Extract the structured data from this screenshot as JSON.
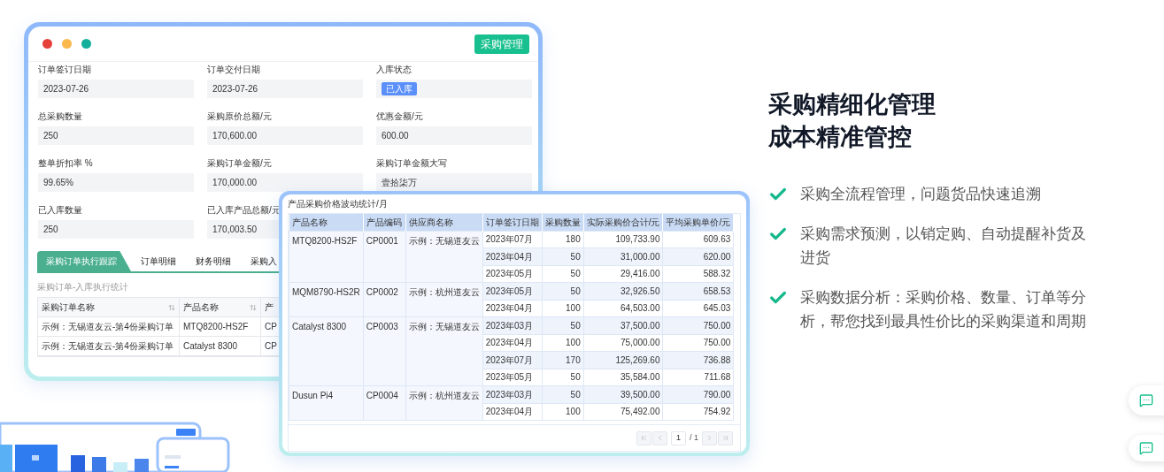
{
  "form_window": {
    "badge": "采购管理",
    "fields": [
      {
        "label": "订单签订日期",
        "value": "2023-07-26",
        "kind": "text"
      },
      {
        "label": "订单交付日期",
        "value": "2023-07-26",
        "kind": "text"
      },
      {
        "label": "入库状态",
        "value": "已入库",
        "kind": "tag"
      },
      {
        "label": "总采购数量",
        "value": "250",
        "kind": "text"
      },
      {
        "label": "采购原价总额/元",
        "value": "170,600.00",
        "kind": "text"
      },
      {
        "label": "优惠金额/元",
        "value": "600.00",
        "kind": "text"
      },
      {
        "label": "整单折扣率 %",
        "value": "99.65%",
        "kind": "text"
      },
      {
        "label": "采购订单金额/元",
        "value": "170,000.00",
        "kind": "text"
      },
      {
        "label": "采购订单金额大写",
        "value": "壹拾柒万",
        "kind": "text"
      },
      {
        "label": "已入库数量",
        "value": "250",
        "kind": "text"
      },
      {
        "label": "已入库产品总额/元",
        "value": "170,003.50",
        "kind": "text"
      }
    ],
    "tabs": [
      {
        "label": "采购订单执行跟踪",
        "selected": true
      },
      {
        "label": "订单明细",
        "selected": false
      },
      {
        "label": "财务明细",
        "selected": false
      },
      {
        "label": "采购入",
        "selected": false
      }
    ],
    "table_title": "采购订单-入库执行统计",
    "table": {
      "columns": [
        {
          "label": "采购订单名称",
          "sortable": true
        },
        {
          "label": "产品名称",
          "sortable": true
        },
        {
          "label": "产"
        }
      ],
      "rows": [
        [
          "示例：无锡道友云-第4份采购订单",
          "MTQ8200-HS2F",
          "CP"
        ],
        [
          "示例：无锡道友云-第4份采购订单",
          "Catalyst 8300",
          "CP"
        ]
      ]
    }
  },
  "price_window": {
    "title": "产品采购价格波动统计/月",
    "columns": [
      "产品名称",
      "产品编码",
      "供应商名称",
      "订单签订日期",
      "采购数量",
      "实际采购价合计/元",
      "平均采购单价/元"
    ],
    "products": [
      {
        "name": "MTQ8200-HS2F",
        "code": "CP0001",
        "supplier": "示例：无锡道友云",
        "months": [
          [
            "2023年07月",
            "180",
            "109,733.90",
            "609.63"
          ],
          [
            "2023年04月",
            "50",
            "31,000.00",
            "620.00"
          ],
          [
            "2023年05月",
            "50",
            "29,416.00",
            "588.32"
          ]
        ]
      },
      {
        "name": "MQM8790-HS2R",
        "code": "CP0002",
        "supplier": "示例：杭州道友云",
        "months": [
          [
            "2023年05月",
            "50",
            "32,926.50",
            "658.53"
          ],
          [
            "2023年04月",
            "100",
            "64,503.00",
            "645.03"
          ]
        ]
      },
      {
        "name": "Catalyst 8300",
        "code": "CP0003",
        "supplier": "示例：无锡道友云",
        "months": [
          [
            "2023年03月",
            "50",
            "37,500.00",
            "750.00"
          ],
          [
            "2023年04月",
            "100",
            "75,000.00",
            "750.00"
          ],
          [
            "2023年07月",
            "170",
            "125,269.60",
            "736.88"
          ],
          [
            "2023年05月",
            "50",
            "35,584.00",
            "711.68"
          ]
        ]
      },
      {
        "name": "Dusun Pi4",
        "code": "CP0004",
        "supplier": "示例：杭州道友云",
        "months": [
          [
            "2023年03月",
            "50",
            "39,500.00",
            "790.00"
          ],
          [
            "2023年04月",
            "100",
            "75,492.00",
            "754.92"
          ]
        ]
      }
    ],
    "pagination": {
      "page": "1",
      "total": "/ 1"
    }
  },
  "feature": {
    "headline": [
      "采购精细化管理",
      "成本精准管控"
    ],
    "bullets": [
      "采购全流程管理，问题货品快速追溯",
      "采购需求预测，以销定购、自动提醒补货及进货",
      "采购数据分析：采购价格、数量、订单等分析，帮您找到最具性价比的采购渠道和周期"
    ]
  }
}
